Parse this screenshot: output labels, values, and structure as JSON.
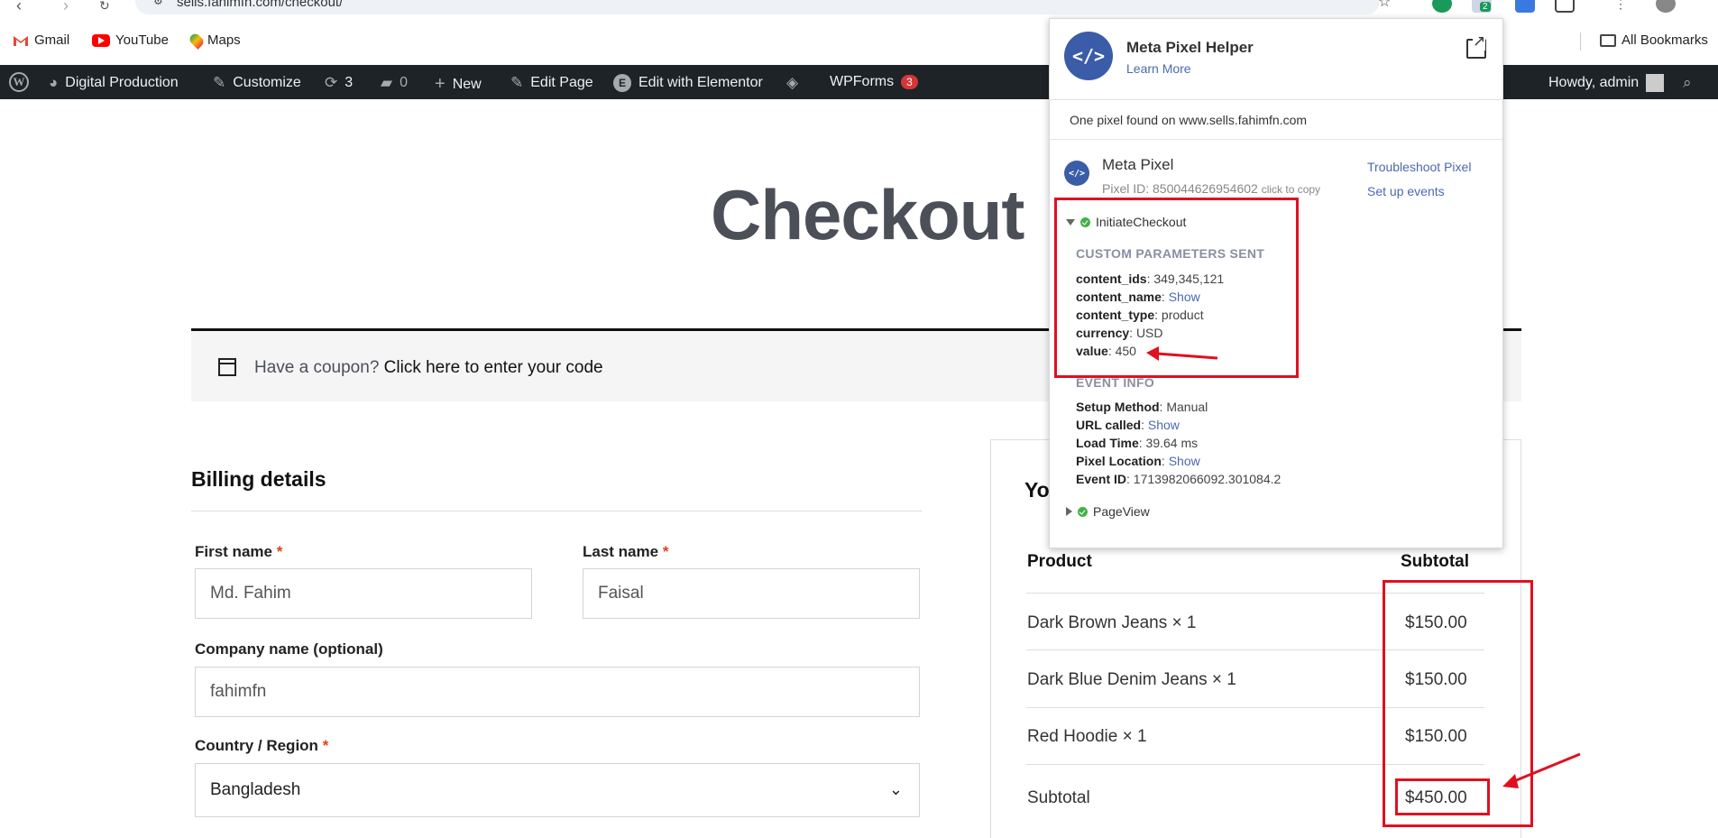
{
  "browser": {
    "url": "sells.fahimfn.com/checkout/",
    "bookmarks": [
      {
        "label": "Gmail",
        "icon": "gmail-icon"
      },
      {
        "label": "YouTube",
        "icon": "youtube-icon"
      },
      {
        "label": "Maps",
        "icon": "maps-icon"
      }
    ],
    "all_bookmarks": "All Bookmarks",
    "extension_badge": "2"
  },
  "adminbar": {
    "site": "Digital Production",
    "customize": "Customize",
    "updates": "3",
    "comments": "0",
    "new": "New",
    "edit_page": "Edit Page",
    "elementor": "Edit with Elementor",
    "wpforms": "WPForms",
    "wpforms_count": "3",
    "howdy": "Howdy, admin"
  },
  "page": {
    "title": "Checkout",
    "coupon_text": "Have a coupon?",
    "coupon_link": "Click here to enter your code",
    "billing_title": "Billing details",
    "first_name_label": "First name",
    "first_name_value": "Md. Fahim",
    "last_name_label": "Last name",
    "last_name_value": "Faisal",
    "company_label": "Company name (optional)",
    "company_value": "fahimfn",
    "country_label": "Country / Region",
    "country_value": "Bangladesh",
    "required_mark": "*"
  },
  "order": {
    "title_partial": "Yo",
    "col_product": "Product",
    "col_subtotal": "Subtotal",
    "items": [
      {
        "name": "Dark Brown Jeans × 1",
        "price": "$150.00"
      },
      {
        "name": "Dark Blue Denim Jeans × 1",
        "price": "$150.00"
      },
      {
        "name": "Red Hoodie × 1",
        "price": "$150.00"
      }
    ],
    "subtotal_label": "Subtotal",
    "subtotal_value": "$450.00"
  },
  "meta_popup": {
    "title": "Meta Pixel Helper",
    "learn_more": "Learn More",
    "found_text": "One pixel found on www.sells.fahimfn.com",
    "pixel_name": "Meta Pixel",
    "pixel_id": "Pixel ID: 850044626954602",
    "click_to_copy": "click to copy",
    "troubleshoot": "Troubleshoot Pixel",
    "setup_events": "Set up events",
    "event1": "InitiateCheckout",
    "custom_params_heading": "CUSTOM PARAMETERS SENT",
    "params": [
      {
        "key": "content_ids",
        "value": "349,345,121",
        "link": false
      },
      {
        "key": "content_name",
        "value": "Show",
        "link": true
      },
      {
        "key": "content_type",
        "value": "product",
        "link": false
      },
      {
        "key": "currency",
        "value": "USD",
        "link": false
      },
      {
        "key": "value",
        "value": "450",
        "link": false
      }
    ],
    "event_info_heading": "EVENT INFO",
    "event_info": [
      {
        "key": "Setup Method",
        "value": "Manual",
        "link": false
      },
      {
        "key": "URL called",
        "value": "Show",
        "link": true
      },
      {
        "key": "Load Time",
        "value": "39.64 ms",
        "link": false
      },
      {
        "key": "Pixel Location",
        "value": "Show",
        "link": true
      },
      {
        "key": "Event ID",
        "value": "1713982066092.301084.2",
        "link": false
      }
    ],
    "event2": "PageView"
  },
  "colors": {
    "admin_bar": "#1d2327",
    "meta_blue": "#3b5ca8",
    "annotation_red": "#e01020",
    "success_green": "#45b04a"
  }
}
